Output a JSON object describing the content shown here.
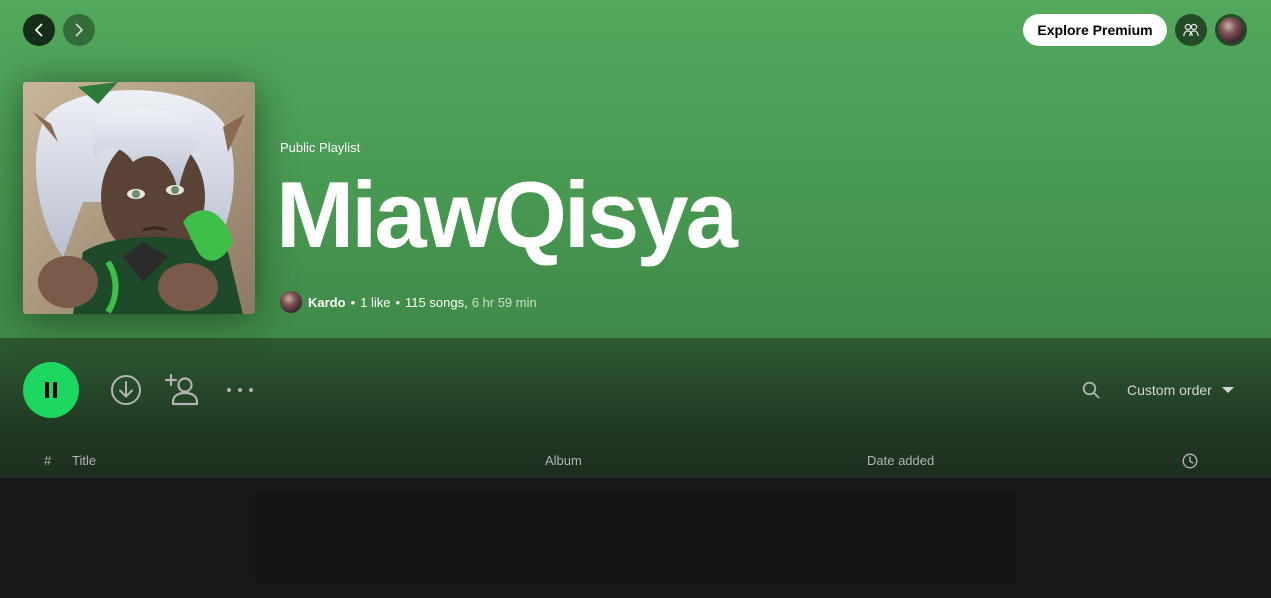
{
  "topbar": {
    "back_icon": "chevron-left-icon",
    "forward_icon": "chevron-right-icon",
    "premium_label": "Explore Premium",
    "friends_icon": "friends-icon",
    "profile_icon": "user-avatar"
  },
  "playlist": {
    "type_label": "Public Playlist",
    "title": "MiawQisya",
    "owner": "Kardo",
    "likes": "1 like",
    "songs": "115 songs,",
    "duration": "6 hr 59 min"
  },
  "actions": {
    "play_icon": "pause-icon",
    "download_icon": "download-icon",
    "add_user_icon": "add-user-icon",
    "more_icon": "more-icon",
    "search_icon": "search-icon",
    "sort_label": "Custom order"
  },
  "table": {
    "col_index": "#",
    "col_title": "Title",
    "col_album": "Album",
    "col_date": "Date added",
    "duration_icon": "clock-icon"
  },
  "colors": {
    "hero": "#4f9f58",
    "accent": "#1ed760",
    "background": "#121212"
  }
}
